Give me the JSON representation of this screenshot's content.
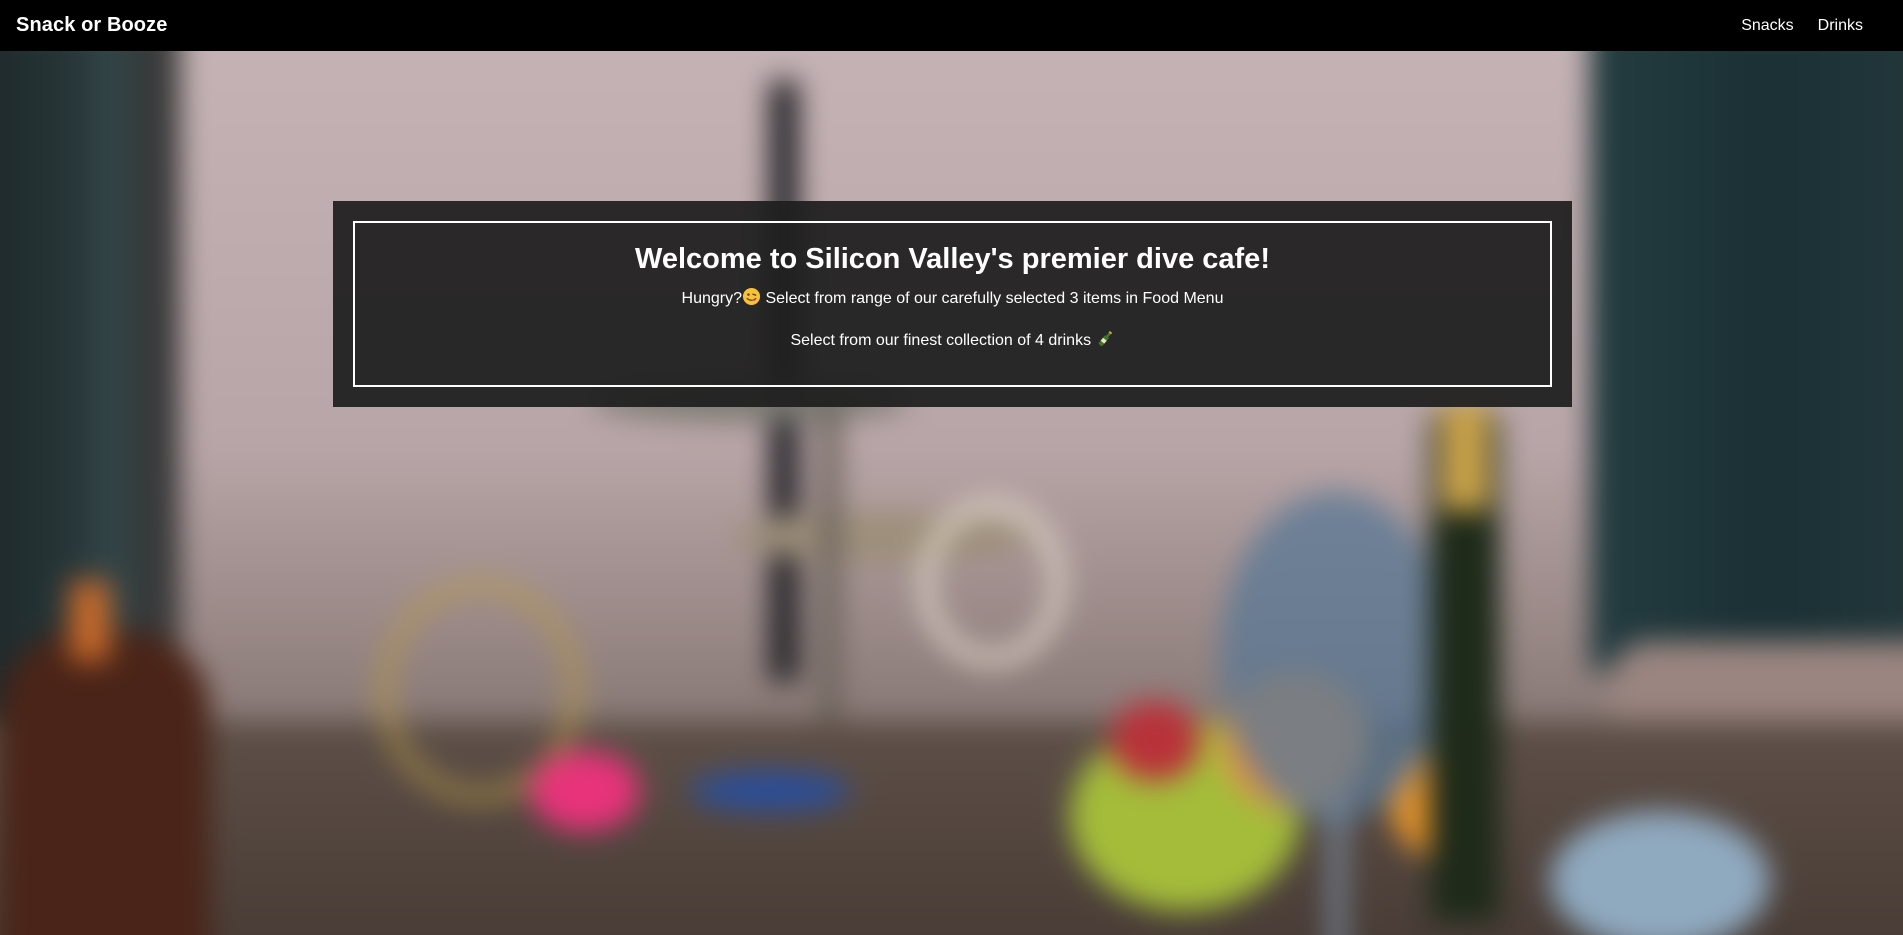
{
  "navbar": {
    "brand": "Snack or Booze",
    "links": [
      "Snacks",
      "Drinks"
    ]
  },
  "hero": {
    "title": "Welcome to Silicon Valley's premier dive cafe!",
    "snacks_line": {
      "prefix": "Hungry?",
      "text": " Select from range of our carefully selected 3 items in Food Menu"
    },
    "drinks_line": {
      "text": "Select from our finest collection of 4 drinks "
    }
  },
  "icons": {
    "hungry": "yum-face-emoji-icon",
    "drinks": "bottle-emoji-icon"
  },
  "colors": {
    "navbar_bg": "#000000",
    "card_bg": "#1e1e1e",
    "text": "#ffffff"
  }
}
